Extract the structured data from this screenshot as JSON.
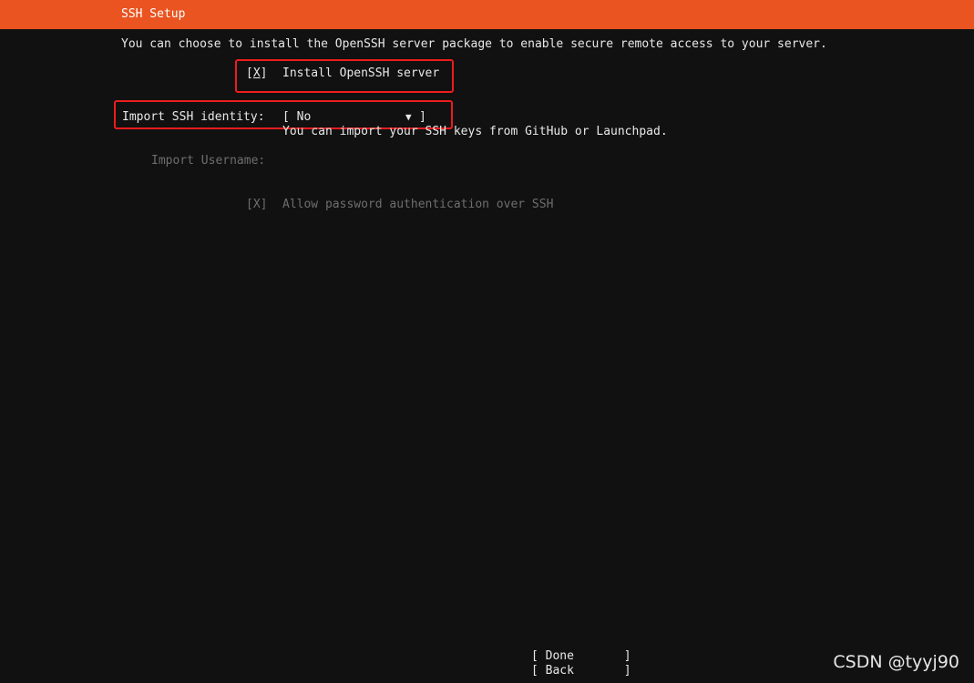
{
  "header": {
    "title": "SSH Setup",
    "color": "#e95420"
  },
  "intro": "You can choose to install the OpenSSH server package to enable secure remote access to your server.",
  "install_openssh": {
    "checkbox_open": "[",
    "checkbox_mark": "X",
    "checkbox_close": "]",
    "checked": true,
    "label": "Install OpenSSH server"
  },
  "import_identity": {
    "label": "Import SSH identity:",
    "select_open": "[ No",
    "arrow": "▼",
    "select_close": "]",
    "value": "No",
    "help": "You can import your SSH keys from GitHub or Launchpad."
  },
  "import_username": {
    "label": "Import Username:"
  },
  "allow_password": {
    "checkbox": "[X]",
    "checked": true,
    "label": "Allow password authentication over SSH"
  },
  "buttons": {
    "done": "[ Done       ]",
    "back": "[ Back       ]"
  },
  "watermark": "CSDN @tyyj90",
  "highlight_color": "#ee1c1c"
}
